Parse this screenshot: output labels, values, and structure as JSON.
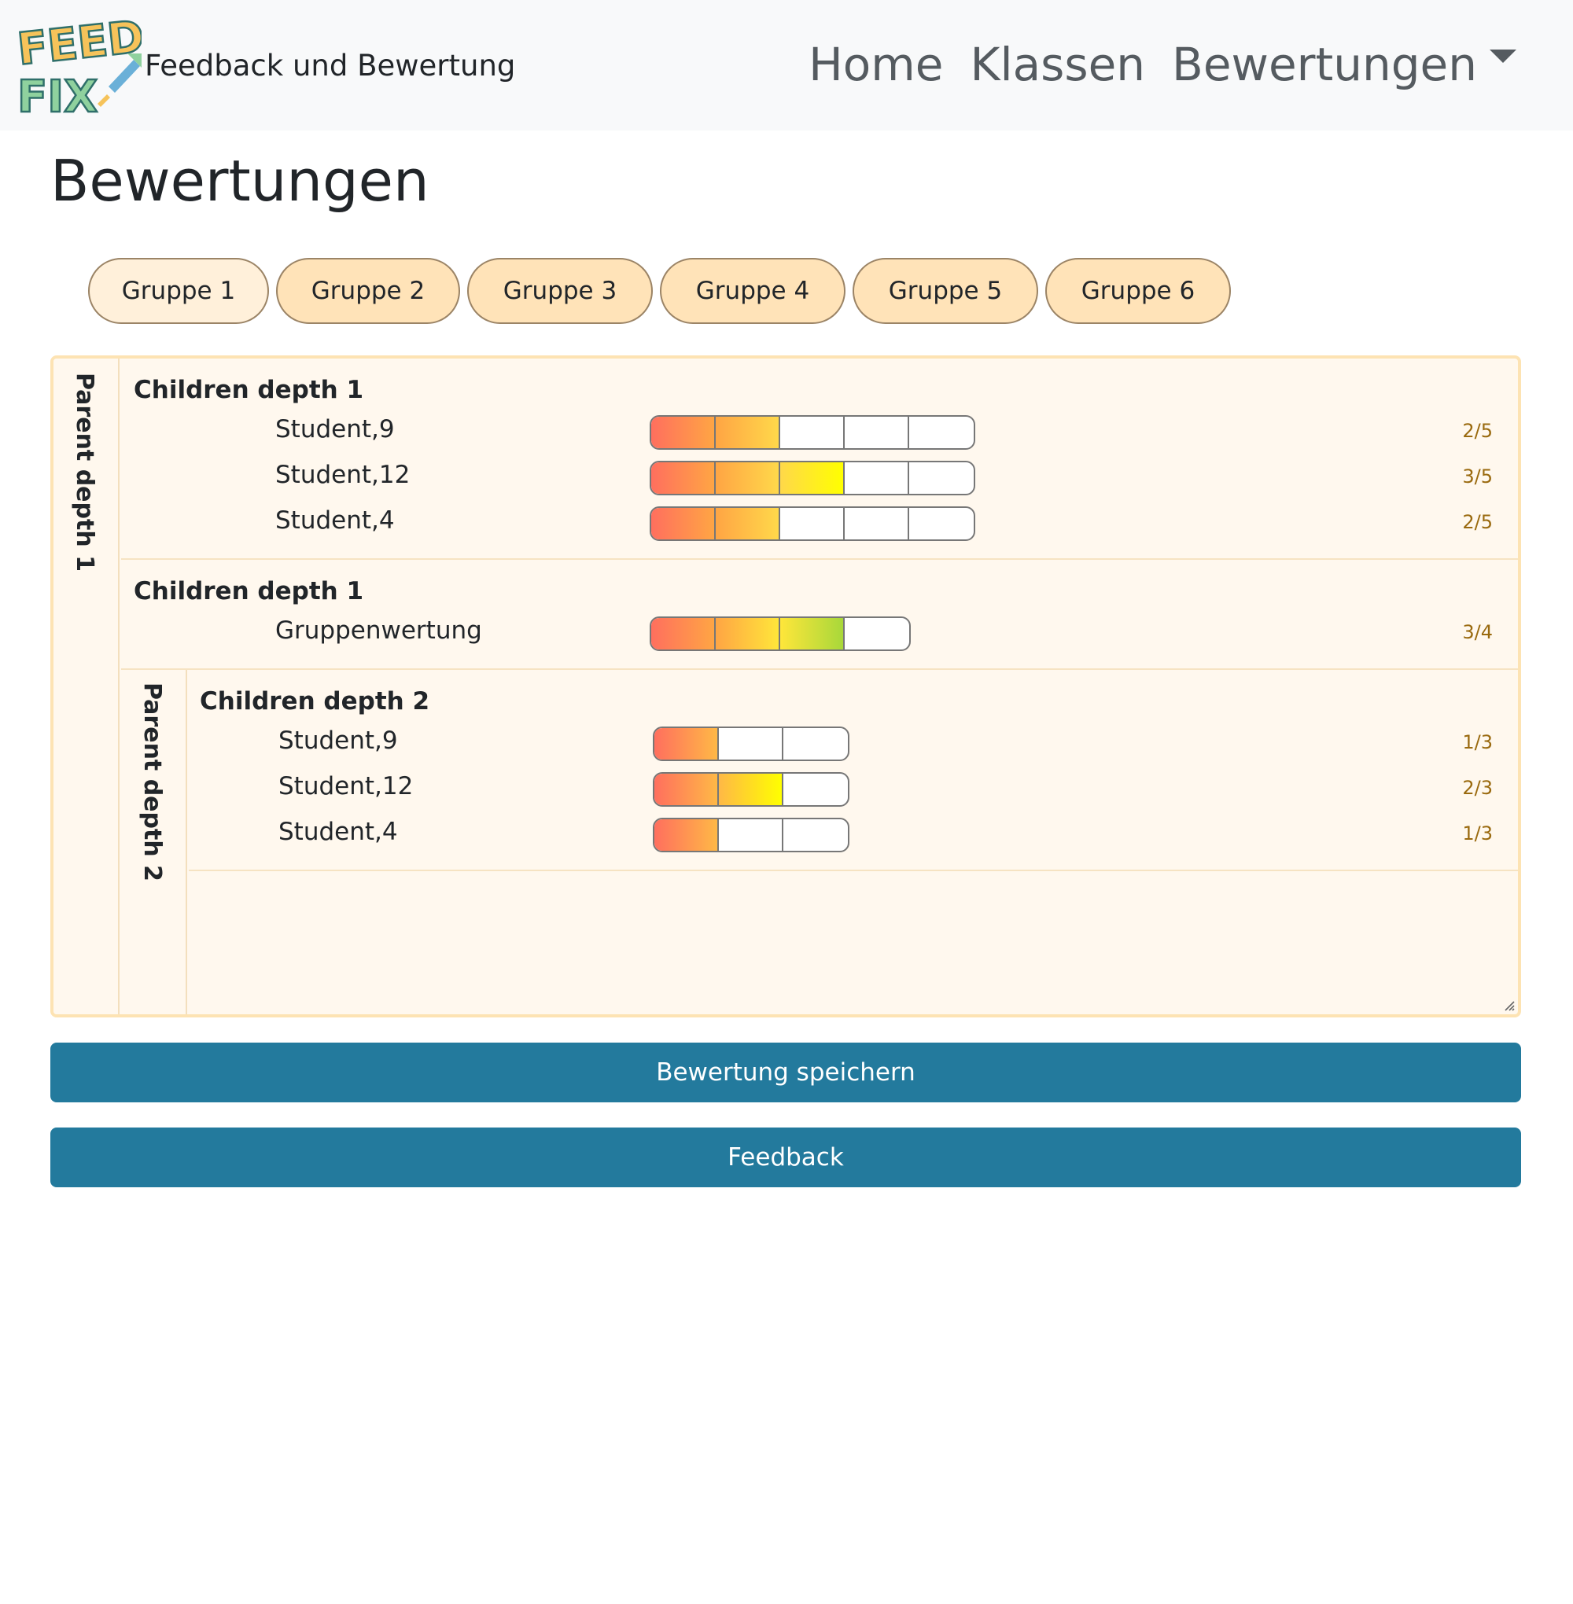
{
  "nav": {
    "logo_text": [
      "FEED",
      "FIX"
    ],
    "brand": "Feedback und Bewertung",
    "links": [
      {
        "label": "Home"
      },
      {
        "label": "Klassen"
      },
      {
        "label": "Bewertungen"
      }
    ]
  },
  "page": {
    "title": "Bewertungen"
  },
  "tabs": [
    {
      "label": "Gruppe 1",
      "active": true
    },
    {
      "label": "Gruppe 2",
      "active": false
    },
    {
      "label": "Gruppe 3",
      "active": false
    },
    {
      "label": "Gruppe 4",
      "active": false
    },
    {
      "label": "Gruppe 5",
      "active": false
    },
    {
      "label": "Gruppe 6",
      "active": false
    }
  ],
  "rubric": {
    "parent1": {
      "label": "Parent depth 1"
    },
    "parent2": {
      "label": "Parent depth 2"
    },
    "sections": [
      {
        "title": "Children depth 1",
        "rows": [
          {
            "label": "Student,9",
            "score": "2/5",
            "value": 2,
            "max": 5
          },
          {
            "label": "Student,12",
            "score": "3/5",
            "value": 3,
            "max": 5
          },
          {
            "label": "Student,4",
            "score": "2/5",
            "value": 2,
            "max": 5
          }
        ]
      },
      {
        "title": "Children depth 1",
        "rows": [
          {
            "label": "Gruppenwertung",
            "score": "3/4",
            "value": 3,
            "max": 4
          }
        ]
      },
      {
        "title": "Children depth 2",
        "rows": [
          {
            "label": "Student,9",
            "score": "1/3",
            "value": 1,
            "max": 3
          },
          {
            "label": "Student,12",
            "score": "2/3",
            "value": 2,
            "max": 3
          },
          {
            "label": "Student,4",
            "score": "1/3",
            "value": 1,
            "max": 3
          }
        ]
      }
    ]
  },
  "buttons": {
    "save": "Bewertung speichern",
    "feedback": "Feedback"
  },
  "colors": {
    "navbar_bg": "#f8f9fa",
    "tab_bg": "#ffe3b8",
    "panel_bg": "#fff8ee",
    "panel_border": "#fde3b3",
    "button_bg": "#237a9d",
    "score_text": "#9a6a0f"
  }
}
